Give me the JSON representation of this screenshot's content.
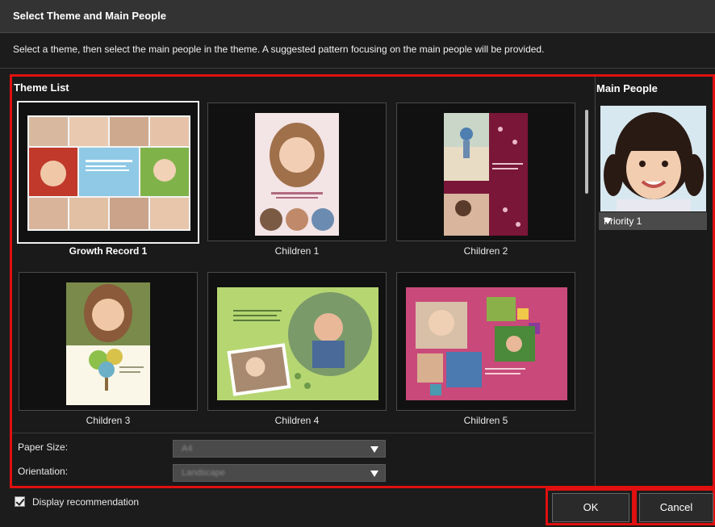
{
  "dialog": {
    "title": "Select Theme and Main People",
    "description": "Select a theme, then select the main people in the theme. A suggested pattern focusing on the main people will be provided."
  },
  "theme_list": {
    "label": "Theme List",
    "themes": [
      {
        "name": "Growth Record 1",
        "selected": true
      },
      {
        "name": "Children 1",
        "selected": false
      },
      {
        "name": "Children 2",
        "selected": false
      },
      {
        "name": "Children 3",
        "selected": false
      },
      {
        "name": "Children 4",
        "selected": false
      },
      {
        "name": "Children 5",
        "selected": false
      }
    ]
  },
  "options": {
    "paper_size_label": "Paper Size:",
    "paper_size_value": "A4",
    "orientation_label": "Orientation:",
    "orientation_value": "Landscape"
  },
  "main_people": {
    "label": "Main People",
    "priority": "Priority 1"
  },
  "footer": {
    "display_recommendation": "Display recommendation",
    "display_recommendation_checked": true,
    "ok": "OK",
    "cancel": "Cancel"
  },
  "colors": {
    "highlight": "#e01010",
    "background": "#1c1c1c"
  }
}
